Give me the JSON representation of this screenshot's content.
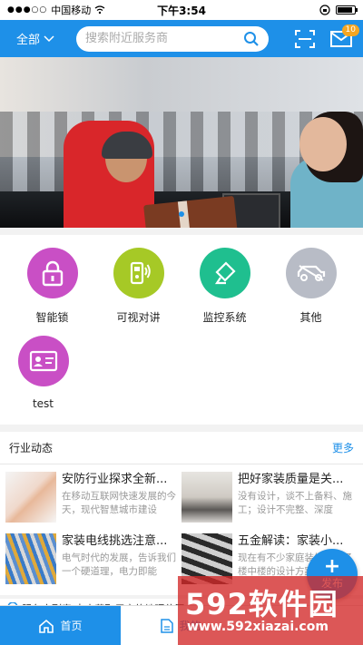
{
  "status_bar": {
    "carrier": "中国移动",
    "time": "下午3:54"
  },
  "header": {
    "city": "全部",
    "search_placeholder": "搜索附近服务商",
    "badge_count": "10"
  },
  "categories": [
    {
      "label": "智能锁",
      "color": "#c94fc5",
      "icon": "lock-icon"
    },
    {
      "label": "可视对讲",
      "color": "#a6c926",
      "icon": "intercom-icon"
    },
    {
      "label": "监控系统",
      "color": "#1fbf8f",
      "icon": "camera-icon"
    },
    {
      "label": "其他",
      "color": "#b8bcc6",
      "icon": "car-icon"
    },
    {
      "label": "test",
      "color": "#c94fc5",
      "icon": "id-card-icon"
    }
  ],
  "news": {
    "heading": "行业动态",
    "more": "更多",
    "items": [
      {
        "title": "安防行业探求全新...",
        "desc": "在移动互联网快速发展的今天，现代智慧城市建设",
        "thumb": "hands-thumb"
      },
      {
        "title": "把好家装质量是关...",
        "desc": "没有设计，谈不上备料、施工；设计不完整、深度",
        "thumb": "room-thumb"
      },
      {
        "title": "家装电线挑选注意...",
        "desc": "电气时代的发展，告诉我们一个硬道理，电力即能",
        "thumb": "wires-thumb"
      },
      {
        "title": "五金解读：家装小...",
        "desc": "现在有不少家庭装修采用了楼中楼的设计方案，",
        "thumb": "stairs-thumb"
      }
    ]
  },
  "location_text": "服务商列表 点击获取用户的地理位置",
  "tabbar": {
    "home": "首页",
    "mine": "我的"
  },
  "fab": {
    "label": "发布"
  },
  "watermark": {
    "big": "592软件园",
    "url": "www.592xiazai.com"
  },
  "colors": {
    "primary": "#1e90e8"
  }
}
